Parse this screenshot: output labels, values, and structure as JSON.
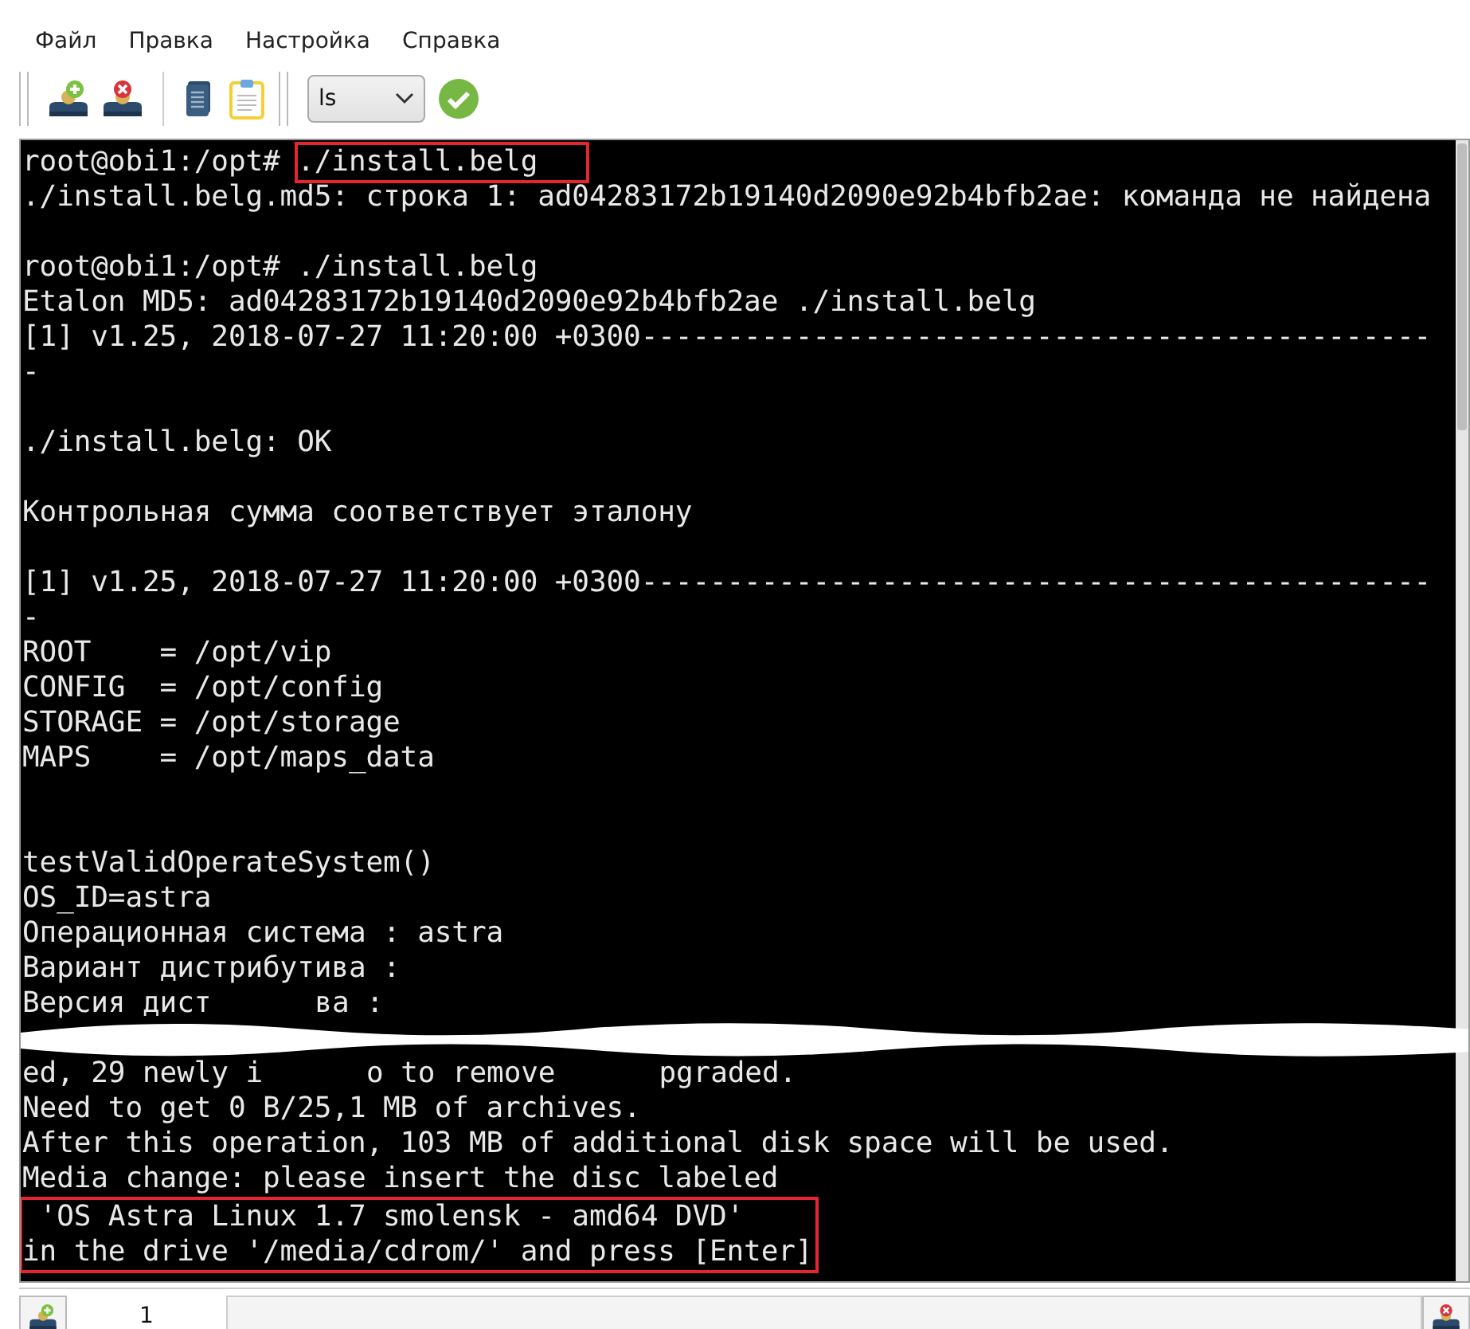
{
  "menu": [
    {
      "label": "Файл"
    },
    {
      "label": "Правка"
    },
    {
      "label": "Настройка"
    },
    {
      "label": "Справка"
    }
  ],
  "toolbar": {
    "command_combo": {
      "value": "ls"
    }
  },
  "terminal": {
    "lines": [
      {
        "kind": "prompt",
        "prompt": "root@obi1:/opt#",
        "command": "./install.belg",
        "command_highlighted": true
      },
      {
        "kind": "text",
        "text": "./install.belg.md5: строка 1: ad04283172b19140d2090e92b4bfb2ae: команда не найдена",
        "highlighted": false
      },
      {
        "kind": "blank"
      },
      {
        "kind": "prompt",
        "prompt": "root@obi1:/opt#",
        "command": "./install.belg",
        "command_highlighted": false
      },
      {
        "kind": "text",
        "text": "Etalon MD5: ad04283172b19140d2090e92b4bfb2ae ./install.belg",
        "highlighted": false
      },
      {
        "kind": "text",
        "text": "[1] v1.25, 2018-07-27 11:20:00 +0300----------------------------------------------",
        "highlighted": false
      },
      {
        "kind": "text",
        "text": "-",
        "highlighted": false
      },
      {
        "kind": "blank"
      },
      {
        "kind": "text",
        "text": "./install.belg: OK",
        "highlighted": false
      },
      {
        "kind": "blank"
      },
      {
        "kind": "text",
        "text": "Контрольная сумма соответствует эталону",
        "highlighted": false
      },
      {
        "kind": "blank"
      },
      {
        "kind": "text",
        "text": "[1] v1.25, 2018-07-27 11:20:00 +0300----------------------------------------------",
        "highlighted": false
      },
      {
        "kind": "text",
        "text": "-",
        "highlighted": false
      },
      {
        "kind": "text",
        "text": "ROOT    = /opt/vip",
        "highlighted": false
      },
      {
        "kind": "text",
        "text": "CONFIG  = /opt/config",
        "highlighted": false
      },
      {
        "kind": "text",
        "text": "STORAGE = /opt/storage",
        "highlighted": false
      },
      {
        "kind": "text",
        "text": "MAPS    = /opt/maps_data",
        "highlighted": false
      },
      {
        "kind": "blank"
      },
      {
        "kind": "blank"
      },
      {
        "kind": "text",
        "text": "testValidOperateSystem()",
        "highlighted": false
      },
      {
        "kind": "text",
        "text": "OS_ID=astra",
        "highlighted": false
      },
      {
        "kind": "text",
        "text": "Операционная система : astra",
        "highlighted": false
      },
      {
        "kind": "text",
        "text": "Вариант дистрибутива :",
        "highlighted": false
      },
      {
        "kind": "covered",
        "fragments": [
          "Версия дист",
          "ва :"
        ]
      },
      {
        "kind": "blank"
      },
      {
        "kind": "covered",
        "fragments": [
          "ed, 29 newly i",
          "o to remove",
          "pgraded."
        ]
      },
      {
        "kind": "text",
        "text": "Need to get 0 B/25,1 MB of archives.",
        "highlighted": false
      },
      {
        "kind": "text",
        "text": "After this operation, 103 MB of additional disk space will be used.",
        "highlighted": false
      },
      {
        "kind": "text",
        "text": "Media change: please insert the disc labeled",
        "highlighted": false
      },
      {
        "kind": "text",
        "text": " 'OS Astra Linux 1.7 smolensk - amd64 DVD'",
        "highlighted": true
      },
      {
        "kind": "text",
        "text": "in the drive '/media/cdrom/' and press [Enter]",
        "highlighted": true
      }
    ]
  },
  "tabs": [
    {
      "label": "1",
      "selected": true
    }
  ]
}
